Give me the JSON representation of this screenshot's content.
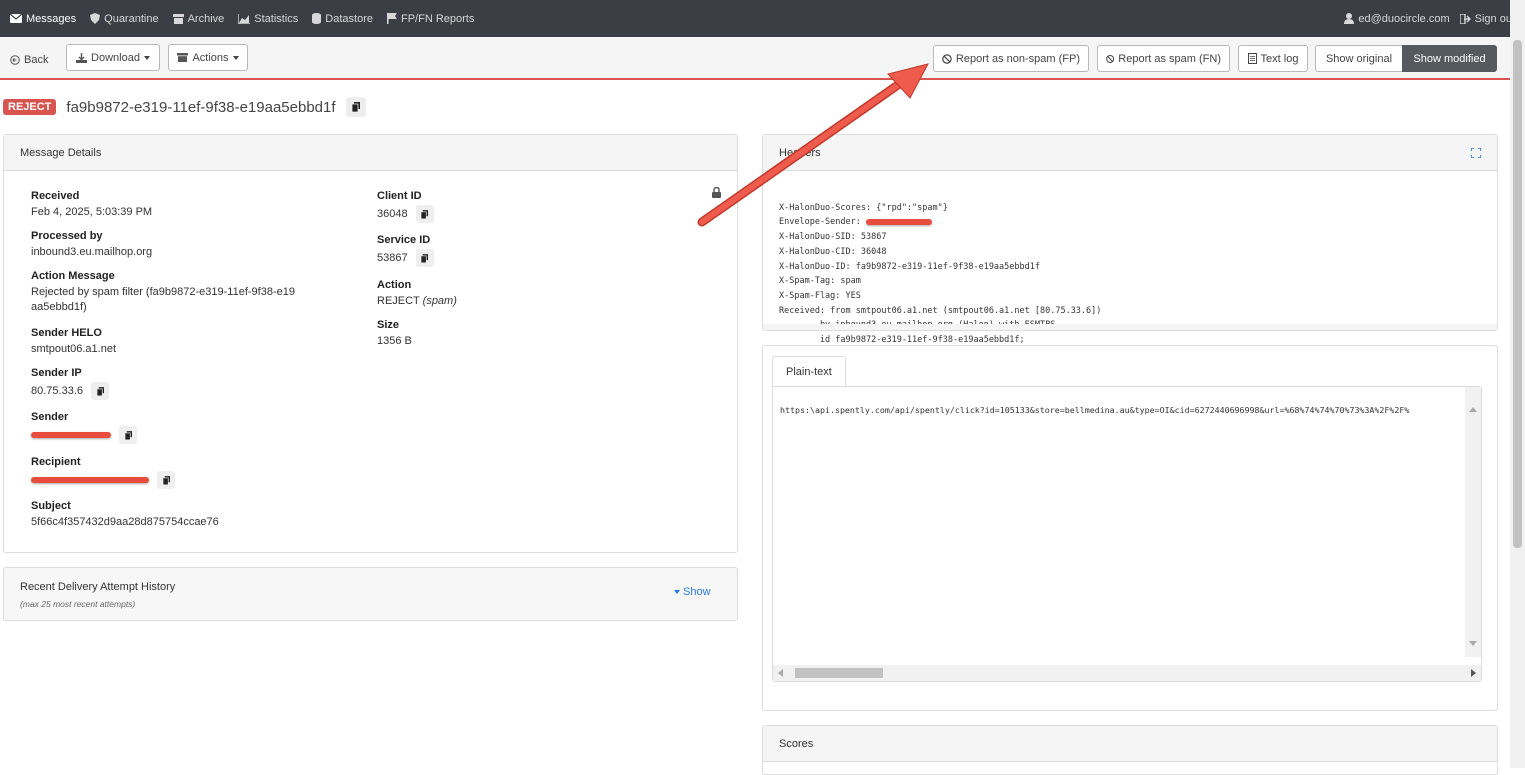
{
  "nav": {
    "items": [
      {
        "label": "Messages",
        "icon": "envelope-icon"
      },
      {
        "label": "Quarantine",
        "icon": "shield-icon"
      },
      {
        "label": "Archive",
        "icon": "archive-icon"
      },
      {
        "label": "Statistics",
        "icon": "chart-icon"
      },
      {
        "label": "Datastore",
        "icon": "database-icon"
      },
      {
        "label": "FP/FN Reports",
        "icon": "flag-icon"
      }
    ],
    "user": "ed@duocircle.com",
    "signout": "Sign out"
  },
  "toolbar": {
    "back": "Back",
    "download": "Download",
    "actions": "Actions",
    "report_fp": "Report as non-spam (FP)",
    "report_fn": "Report as spam (FN)",
    "text_log": "Text log",
    "show_original": "Show original",
    "show_modified": "Show modified"
  },
  "message": {
    "status": "REJECT",
    "id": "fa9b9872-e319-11ef-9f38-e19aa5ebbd1f"
  },
  "details": {
    "title": "Message Details",
    "received_label": "Received",
    "received": "Feb 4, 2025, 5:03:39 PM",
    "processed_label": "Processed by",
    "processed": "inbound3.eu.mailhop.org",
    "action_msg_label": "Action Message",
    "action_msg": "Rejected by spam filter (fa9b9872-e319-11ef-9f38-e19aa5ebbd1f)",
    "helo_label": "Sender HELO",
    "helo": "smtpout06.a1.net",
    "ip_label": "Sender IP",
    "ip": "80.75.33.6",
    "sender_label": "Sender",
    "recipient_label": "Recipient",
    "subject_label": "Subject",
    "subject": "5f66c4f357432d9aa28d875754ccae76",
    "client_label": "Client ID",
    "client": "36048",
    "service_label": "Service ID",
    "service": "53867",
    "action_label": "Action",
    "action": "REJECT",
    "action_reason": "(spam)",
    "size_label": "Size",
    "size": "1356 B"
  },
  "history": {
    "title": "Recent Delivery Attempt History",
    "subtitle": "(max 25 most recent attempts)",
    "show": "Show"
  },
  "headers": {
    "title": "Headers",
    "lines": [
      "X-HalonDuo-Scores: {\"rpd\":\"spam\"}",
      "Envelope-Sender: ",
      "X-HalonDuo-SID: 53867",
      "X-HalonDuo-CID: 36048",
      "X-HalonDuo-ID: fa9b9872-e319-11ef-9f38-e19aa5ebbd1f",
      "X-Spam-Tag: spam",
      "X-Spam-Flag: YES",
      "Received: from smtpout06.a1.net (smtpout06.a1.net [80.75.33.6])",
      "        by inbound3.eu.mailhop.org (Halon) with ESMTPS",
      "        id fa9b9872-e319-11ef-9f38-e19aa5ebbd1f;"
    ]
  },
  "body": {
    "tab": "Plain-text",
    "text": "https:\\api.spently.com/api/spently/click?id=105133&store=bellmedina.au&type=OI&cid=6272440696998&url=%68%74%74%70%73%3A%2F%2F%"
  },
  "scores": {
    "title": "Scores"
  }
}
